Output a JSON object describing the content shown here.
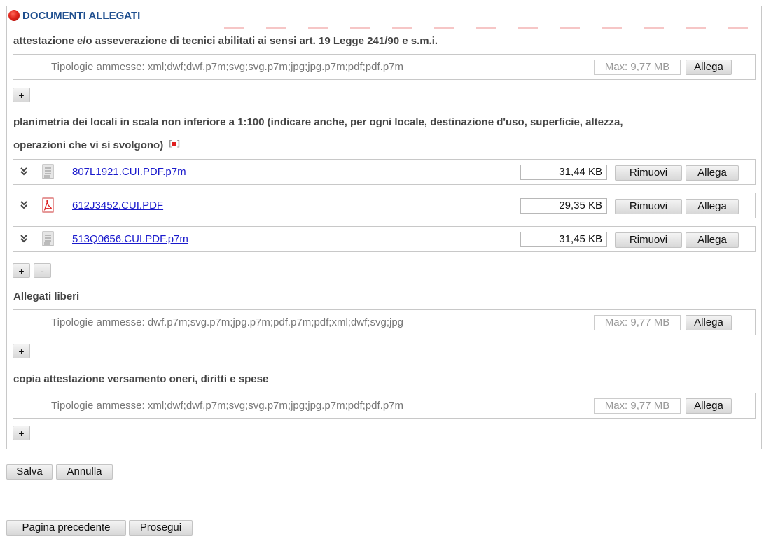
{
  "panel": {
    "title": "DOCUMENTI ALLEGATI"
  },
  "sections": {
    "s1": {
      "title": "attestazione e/o asseverazione di tecnici abilitati ai sensi art. 19 Legge 241/90 e s.m.i.",
      "types": "Tipologie ammesse: xml;dwf;dwf.p7m;svg;svg.p7m;jpg;jpg.p7m;pdf;pdf.p7m",
      "max": "Max: 9,77 MB",
      "attach": "Allega",
      "add": "+"
    },
    "s2": {
      "title_line1": "planimetria dei locali in scala non inferiore a 1:100 (indicare anche, per ogni locale, destinazione d'uso, superficie, altezza,",
      "title_line2": "operazioni che vi si svolgono)",
      "files": [
        {
          "name": "807L1921.CUI.PDF.p7m",
          "size": "31,44 KB",
          "icon": "signed-file-icon"
        },
        {
          "name": "612J3452.CUI.PDF",
          "size": "29,35 KB",
          "icon": "pdf-file-icon"
        },
        {
          "name": "513Q0656.CUI.PDF.p7m",
          "size": "31,45 KB",
          "icon": "signed-file-icon"
        }
      ],
      "remove": "Rimuovi",
      "attach": "Allega",
      "add": "+",
      "minus": "-"
    },
    "s3": {
      "title": "Allegati liberi",
      "types": "Tipologie ammesse: dwf.p7m;svg.p7m;jpg.p7m;pdf.p7m;pdf;xml;dwf;svg;jpg",
      "max": "Max: 9,77 MB",
      "attach": "Allega",
      "add": "+"
    },
    "s4": {
      "title": "copia attestazione versamento oneri, diritti e spese",
      "types": "Tipologie ammesse: xml;dwf;dwf.p7m;svg;svg.p7m;jpg;jpg.p7m;pdf;pdf.p7m",
      "max": "Max: 9,77 MB",
      "attach": "Allega",
      "add": "+"
    }
  },
  "actions": {
    "save": "Salva",
    "cancel": "Annulla",
    "prev": "Pagina precedente",
    "next": "Prosegui"
  },
  "colors": {
    "title": "#1f4f8f",
    "link": "#1a1acc",
    "status_dot": "#e0251b"
  }
}
